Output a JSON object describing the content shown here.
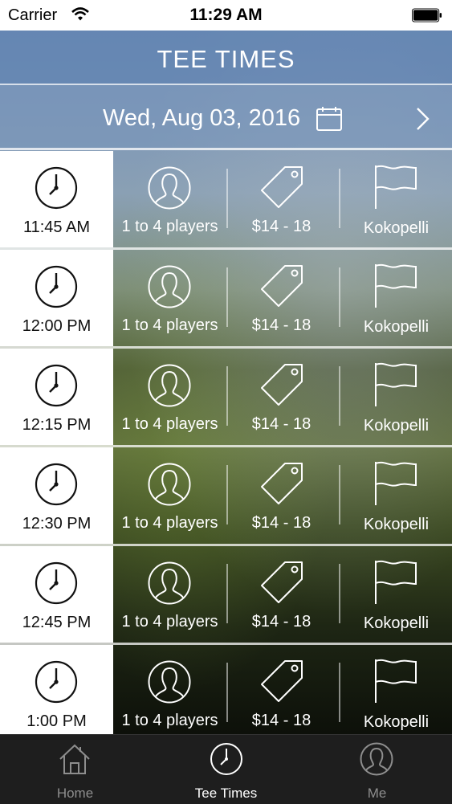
{
  "status_bar": {
    "carrier": "Carrier",
    "time": "11:29 AM"
  },
  "header": {
    "title": "TEE TIMES"
  },
  "date_bar": {
    "date": "Wed, Aug 03, 2016",
    "calendar_icon": "calendar-icon",
    "next_icon": "chevron-right-icon"
  },
  "tee_times": [
    {
      "time": "11:45 AM",
      "players": "1 to 4 players",
      "price": "$14 - 18",
      "course": "Kokopelli"
    },
    {
      "time": "12:00 PM",
      "players": "1 to 4 players",
      "price": "$14 - 18",
      "course": "Kokopelli"
    },
    {
      "time": "12:15 PM",
      "players": "1 to 4 players",
      "price": "$14 - 18",
      "course": "Kokopelli"
    },
    {
      "time": "12:30 PM",
      "players": "1 to 4 players",
      "price": "$14 - 18",
      "course": "Kokopelli"
    },
    {
      "time": "12:45 PM",
      "players": "1 to 4 players",
      "price": "$14 - 18",
      "course": "Kokopelli"
    },
    {
      "time": "1:00 PM",
      "players": "1 to 4 players",
      "price": "$14 - 18",
      "course": "Kokopelli"
    }
  ],
  "tab_bar": {
    "tabs": [
      {
        "label": "Home",
        "icon": "home-icon"
      },
      {
        "label": "Tee Times",
        "icon": "clock-icon"
      },
      {
        "label": "Me",
        "icon": "user-icon"
      }
    ],
    "active": "Tee Times",
    "active_color": "#ffffff",
    "inactive_color": "#8e8e8e"
  }
}
